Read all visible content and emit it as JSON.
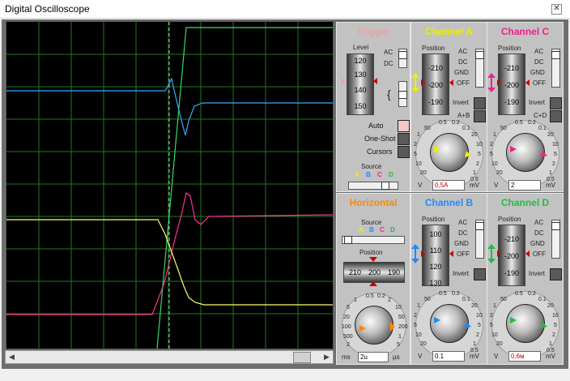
{
  "window": {
    "title": "Digital Oscilloscope",
    "close_glyph": "✕"
  },
  "colors": {
    "trace_a": "#ffff66",
    "trace_b": "#33aaff",
    "trace_c": "#ff3399",
    "trace_d": "#33dd66",
    "grid": "#1f7a1f",
    "panel": "#c2c2c2"
  },
  "scroll": {
    "left_glyph": "◀",
    "right_glyph": "▶"
  },
  "trigger": {
    "title": "Trigger",
    "level_label": "Level",
    "level_ticks": [
      "120",
      "130",
      "140",
      "150"
    ],
    "ac": "AC",
    "dc": "DC",
    "auto": "Auto",
    "one_shot": "One-Shot",
    "cursors": "Cursors",
    "source": "Source",
    "sources": [
      "A",
      "B",
      "C",
      "D"
    ]
  },
  "horizontal": {
    "title": "Horizontal",
    "source": "Source",
    "sources": [
      "A",
      "B",
      "C",
      "D"
    ],
    "position": "Position",
    "drum": [
      "210",
      "200",
      "190"
    ],
    "dial_labels": [
      "0.5",
      "0.2",
      "1",
      "2",
      "5",
      "10",
      "20",
      "50",
      "100",
      "200",
      "500",
      "1",
      "2",
      "5",
      "10",
      "20",
      "50",
      "100",
      "200"
    ],
    "unit_left": "ms",
    "unit_right": "µs",
    "value": "2u"
  },
  "channel_a": {
    "title": "Channel A",
    "position": "Position",
    "drum": [
      "-210",
      "-200",
      "-190"
    ],
    "ac": "AC",
    "dc": "DC",
    "gnd": "GND",
    "off": "OFF",
    "invert": "Invert",
    "combine": "A+B",
    "dial_labels": [
      "0.5",
      "0.2",
      "0.1",
      "50",
      "20",
      "1",
      "10",
      "2",
      "5",
      "5",
      "2",
      "10",
      "1",
      "20",
      "0.5"
    ],
    "unit_left": "V",
    "unit_right": "mV",
    "value": "0,5A"
  },
  "channel_b": {
    "title": "Channel B",
    "position": "Position",
    "drum": [
      "100",
      "110",
      "120",
      "130"
    ],
    "ac": "AC",
    "dc": "DC",
    "gnd": "GND",
    "off": "OFF",
    "invert": "Invert",
    "dial_labels": [
      "0.5",
      "0.2",
      "0.1",
      "50",
      "20",
      "1",
      "10",
      "2",
      "5",
      "5",
      "2",
      "10",
      "1",
      "20",
      "0.5"
    ],
    "unit_left": "V",
    "unit_right": "mV",
    "value": "0.1"
  },
  "channel_c": {
    "title": "Channel C",
    "position": "Position",
    "drum": [
      "-210",
      "-200",
      "-190"
    ],
    "ac": "AC",
    "dc": "DC",
    "gnd": "GND",
    "off": "OFF",
    "invert": "Invert",
    "combine": "C+D",
    "dial_labels": [
      "0.5",
      "0.2",
      "0.1",
      "50",
      "20",
      "1",
      "10",
      "2",
      "5",
      "5",
      "2",
      "10",
      "1",
      "20",
      "0.5"
    ],
    "unit_left": "V",
    "unit_right": "mV",
    "value": "2"
  },
  "channel_d": {
    "title": "Channel D",
    "position": "Position",
    "drum": [
      "-210",
      "-200",
      "-190"
    ],
    "ac": "AC",
    "dc": "DC",
    "gnd": "GND",
    "off": "OFF",
    "invert": "Invert",
    "dial_labels": [
      "0.5",
      "0.2",
      "0.1",
      "50",
      "20",
      "1",
      "10",
      "2",
      "5",
      "5",
      "2",
      "10",
      "1",
      "20",
      "0.5"
    ],
    "unit_left": "V",
    "unit_right": "mV",
    "value": "0,6м"
  }
}
